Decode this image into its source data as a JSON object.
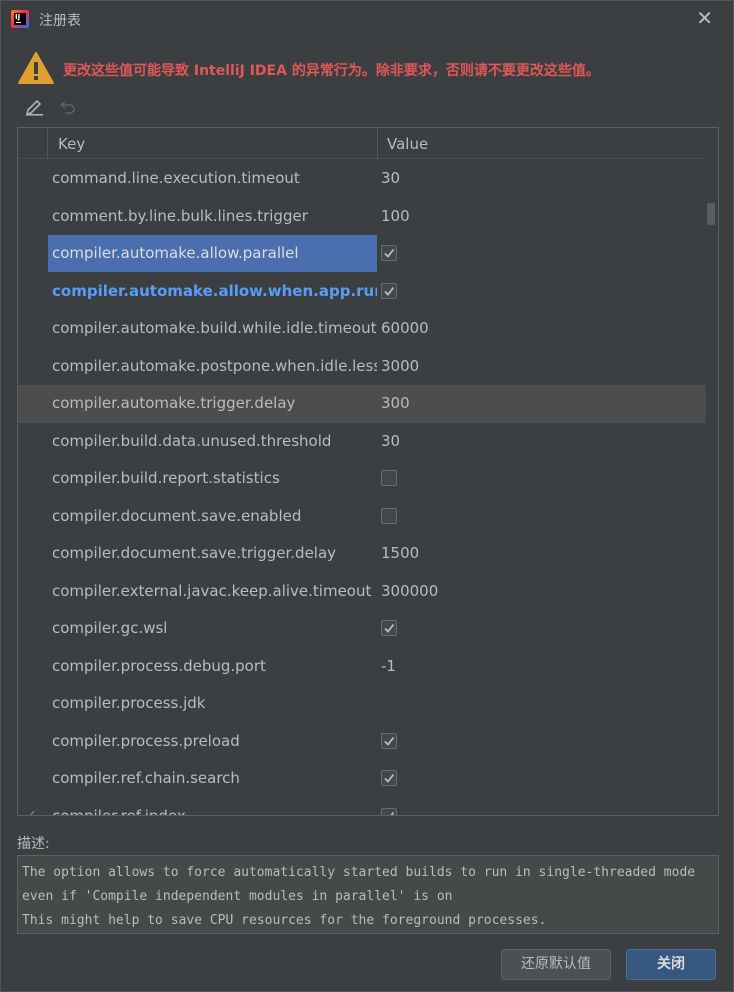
{
  "window": {
    "title": "注册表"
  },
  "warning": {
    "text": "更改这些值可能导致 IntelliJ IDEA 的异常行为。除非要求，否则请不要更改这些值。"
  },
  "table": {
    "columns": {
      "key": "Key",
      "value": "Value"
    },
    "rows": [
      {
        "key": "command.line.execution.timeout",
        "value": "30",
        "type": "text"
      },
      {
        "key": "comment.by.line.bulk.lines.trigger",
        "value": "100",
        "type": "text"
      },
      {
        "key": "compiler.automake.allow.parallel",
        "value": true,
        "type": "bool",
        "selected": true
      },
      {
        "key": "compiler.automake.allow.when.app.running",
        "value": true,
        "type": "bool",
        "modified": true
      },
      {
        "key": "compiler.automake.build.while.idle.timeout",
        "value": "60000",
        "type": "text"
      },
      {
        "key": "compiler.automake.postpone.when.idle.less.than",
        "value": "3000",
        "type": "text"
      },
      {
        "key": "compiler.automake.trigger.delay",
        "value": "300",
        "type": "text",
        "hover": true
      },
      {
        "key": "compiler.build.data.unused.threshold",
        "value": "30",
        "type": "text"
      },
      {
        "key": "compiler.build.report.statistics",
        "value": false,
        "type": "bool"
      },
      {
        "key": "compiler.document.save.enabled",
        "value": false,
        "type": "bool"
      },
      {
        "key": "compiler.document.save.trigger.delay",
        "value": "1500",
        "type": "text"
      },
      {
        "key": "compiler.external.javac.keep.alive.timeout",
        "value": "300000",
        "type": "text"
      },
      {
        "key": "compiler.gc.wsl",
        "value": true,
        "type": "bool"
      },
      {
        "key": "compiler.process.debug.port",
        "value": "-1",
        "type": "text"
      },
      {
        "key": "compiler.process.jdk",
        "value": "",
        "type": "text"
      },
      {
        "key": "compiler.process.preload",
        "value": true,
        "type": "bool"
      },
      {
        "key": "compiler.ref.chain.search",
        "value": true,
        "type": "bool"
      },
      {
        "key": "compiler.ref.index",
        "value": true,
        "type": "bool",
        "partial": true
      }
    ]
  },
  "description": {
    "label": "描述:",
    "lines": [
      "The option allows to force automatically started builds to run in single-threaded mode",
      "even if 'Compile independent modules in parallel' is on",
      "This might help to save CPU resources for the foreground processes."
    ]
  },
  "buttons": {
    "reset": "还原默认值",
    "close": "关闭"
  },
  "colors": {
    "warning": "#e05757",
    "selection": "#4b6eaf",
    "modified": "#589df6",
    "primary_button": "#365880"
  },
  "icons": {
    "app": "intellij-logo-icon",
    "warning": "warning-triangle-icon",
    "edit": "pencil-icon",
    "undo": "undo-icon",
    "close": "close-icon",
    "check": "check-icon"
  }
}
